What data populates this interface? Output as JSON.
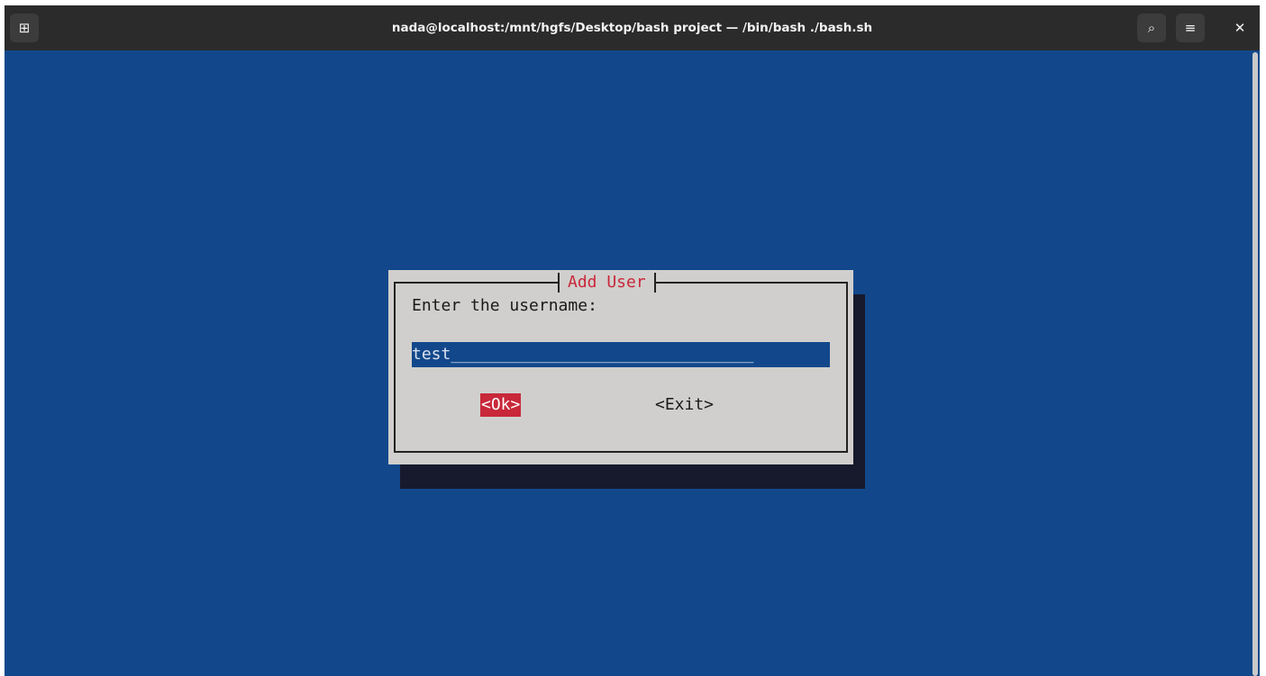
{
  "window": {
    "title": "nada@localhost:/mnt/hgfs/Desktop/bash project — /bin/bash ./bash.sh",
    "new_tab_icon": "⊞",
    "search_icon": "⌕",
    "menu_icon": "≡",
    "close_icon": "✕"
  },
  "dialog": {
    "title": "Add User",
    "prompt": "Enter the username:",
    "input_value": "test",
    "input_underscores": "_______________________________",
    "ok_label": "<Ok>",
    "exit_label": "<Exit>"
  },
  "colors": {
    "terminal_bg": "#12488b",
    "dialog_bg": "#d1cfcd",
    "accent_red": "#c8283a",
    "shadow": "#171a2c"
  }
}
